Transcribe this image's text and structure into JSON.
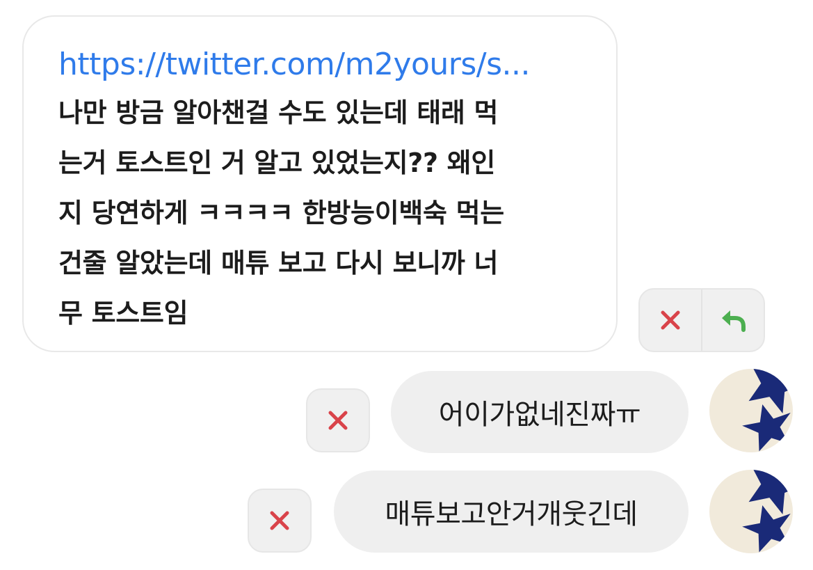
{
  "incoming_message": {
    "link": "https://twitter.com/m2yours/s...",
    "lines": [
      "나만 방금 알아챈걸 수도 있는데 태래 먹",
      "는거 토스트인 거 알고 있었는지?? 왜인",
      "지 당연하게 ㅋㅋㅋㅋ 한방능이백숙 먹는",
      "건줄 알았는데 매튜 보고 다시 보니까 너",
      "무 토스트임"
    ]
  },
  "actions": {
    "delete_icon": "close-x-icon",
    "reply_icon": "reply-arrow-icon",
    "delete_color": "#d9434a",
    "reply_color": "#4caf50"
  },
  "outgoing_messages": [
    {
      "text": "어이가없네진짜ㅠ"
    },
    {
      "text": "매튜보고안거개웃긴데"
    }
  ],
  "colors": {
    "link": "#2f7bea",
    "bubble_out": "#efefef",
    "avatar_bg": "#f1eadb",
    "avatar_star": "#1a2a78"
  }
}
